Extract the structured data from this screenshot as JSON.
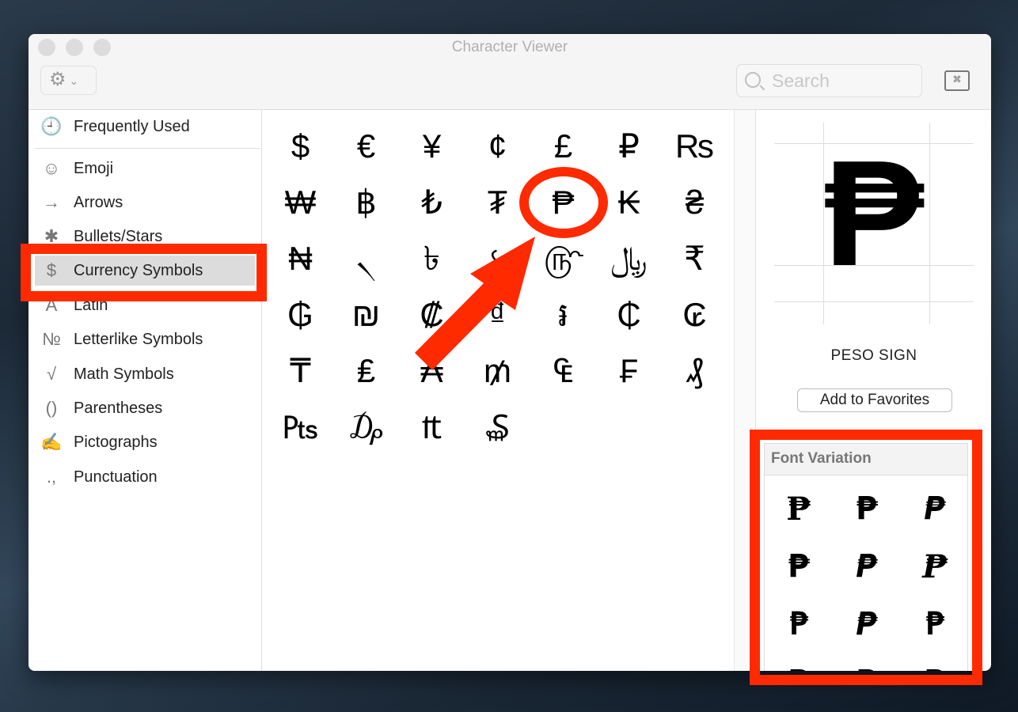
{
  "window": {
    "title": "Character Viewer"
  },
  "toolbar": {
    "gear_icon": "⚙",
    "chevron": "⌄",
    "search_placeholder": "Search",
    "keyboard_icon": "⌘"
  },
  "sidebar": {
    "items": [
      {
        "icon": "🕘",
        "label": "Frequently Used"
      },
      {
        "icon": "☺",
        "label": "Emoji"
      },
      {
        "icon": "→",
        "label": "Arrows"
      },
      {
        "icon": "✱",
        "label": "Bullets/Stars"
      },
      {
        "icon": "$",
        "label": "Currency Symbols",
        "selected": true
      },
      {
        "icon": "A",
        "label": "Latin"
      },
      {
        "icon": "№",
        "label": "Letterlike Symbols"
      },
      {
        "icon": "√",
        "label": "Math Symbols"
      },
      {
        "icon": "()",
        "label": "Parentheses"
      },
      {
        "icon": "✍",
        "label": "Pictographs"
      },
      {
        "icon": ".,",
        "label": "Punctuation"
      }
    ]
  },
  "characters": [
    "$",
    "€",
    "¥",
    "¢",
    "£",
    "₽",
    "₨",
    "₩",
    "฿",
    "₺",
    "₮",
    "₱",
    "₭",
    "₴",
    "₦",
    "৲",
    "৳",
    "৻",
    "௹",
    "﷼",
    "₹",
    "₲",
    "₪",
    "₡",
    "₫",
    "៛",
    "₵",
    "₢",
    "₸",
    "₤",
    "₳",
    "₥",
    "₠",
    "₣",
    "₰",
    "₧",
    "₯",
    "₶",
    "₷"
  ],
  "selected_index": 11,
  "detail": {
    "character": "₱",
    "name": "PESO SIGN",
    "add_favorites": "Add to Favorites"
  },
  "font_variation": {
    "title": "Font Variation",
    "glyphs": [
      "₱",
      "₱",
      "₱",
      "₱",
      "₱",
      "₱",
      "₱",
      "₱",
      "₱",
      "₱",
      "₱",
      "₱"
    ]
  },
  "annotation_color": "#ff2a00"
}
